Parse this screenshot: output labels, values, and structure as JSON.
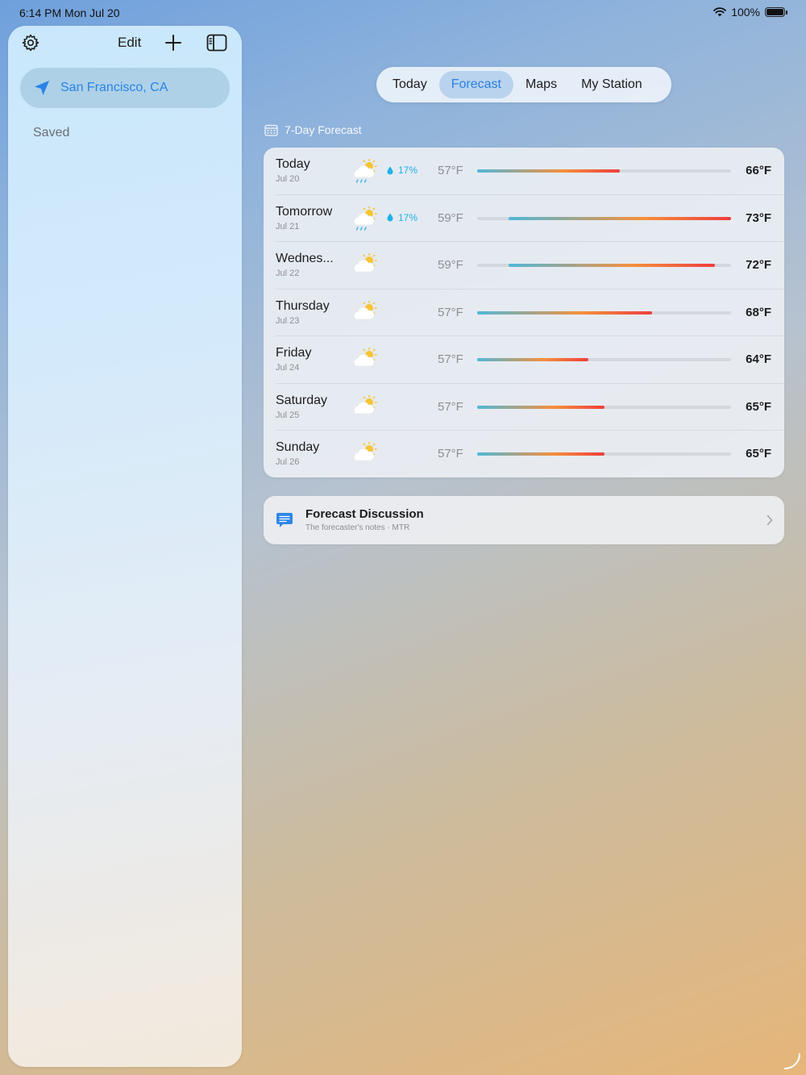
{
  "status_bar": {
    "time": "6:14 PM   Mon Jul 20",
    "battery_text": "100%",
    "battery_level": 1.0
  },
  "sidebar": {
    "edit_label": "Edit",
    "current_location": "San Francisco, CA",
    "saved_label": "Saved",
    "icons": {
      "settings": "gear-icon",
      "add": "plus-icon",
      "toggle": "sidebar-icon",
      "location": "location-arrow-icon"
    }
  },
  "tabs": [
    {
      "label": "Today",
      "active": false
    },
    {
      "label": "Forecast",
      "active": true
    },
    {
      "label": "Maps",
      "active": false
    },
    {
      "label": "My Station",
      "active": false
    }
  ],
  "forecast": {
    "title": "7-Day Forecast",
    "scale_min_f": 57,
    "scale_max_f": 73,
    "days": [
      {
        "name": "Today",
        "date": "Jul 20",
        "icon": "partly-cloudy-rain-icon",
        "precip": "17%",
        "low": "57°F",
        "high": "66°F",
        "low_f": 57,
        "high_f": 66
      },
      {
        "name": "Tomorrow",
        "date": "Jul 21",
        "icon": "partly-cloudy-rain-icon",
        "precip": "17%",
        "low": "59°F",
        "high": "73°F",
        "low_f": 59,
        "high_f": 73
      },
      {
        "name": "Wednes...",
        "date": "Jul 22",
        "icon": "partly-cloudy-icon",
        "precip": "",
        "low": "59°F",
        "high": "72°F",
        "low_f": 59,
        "high_f": 72
      },
      {
        "name": "Thursday",
        "date": "Jul 23",
        "icon": "partly-cloudy-icon",
        "precip": "",
        "low": "57°F",
        "high": "68°F",
        "low_f": 57,
        "high_f": 68
      },
      {
        "name": "Friday",
        "date": "Jul 24",
        "icon": "partly-cloudy-icon",
        "precip": "",
        "low": "57°F",
        "high": "64°F",
        "low_f": 57,
        "high_f": 64
      },
      {
        "name": "Saturday",
        "date": "Jul 25",
        "icon": "partly-cloudy-icon",
        "precip": "",
        "low": "57°F",
        "high": "65°F",
        "low_f": 57,
        "high_f": 65
      },
      {
        "name": "Sunday",
        "date": "Jul 26",
        "icon": "partly-cloudy-icon",
        "precip": "",
        "low": "57°F",
        "high": "65°F",
        "low_f": 57,
        "high_f": 65
      }
    ]
  },
  "discussion": {
    "title": "Forecast Discussion",
    "subtitle": "The forecaster's notes · MTR",
    "icon": "chat-bubble-icon"
  },
  "colors": {
    "accent": "#2a7fe0",
    "precip": "#1fb2e6",
    "bar_cool": "#4fb8d8",
    "bar_warm": "#f5903c",
    "bar_hot": "#ef3e3e"
  }
}
